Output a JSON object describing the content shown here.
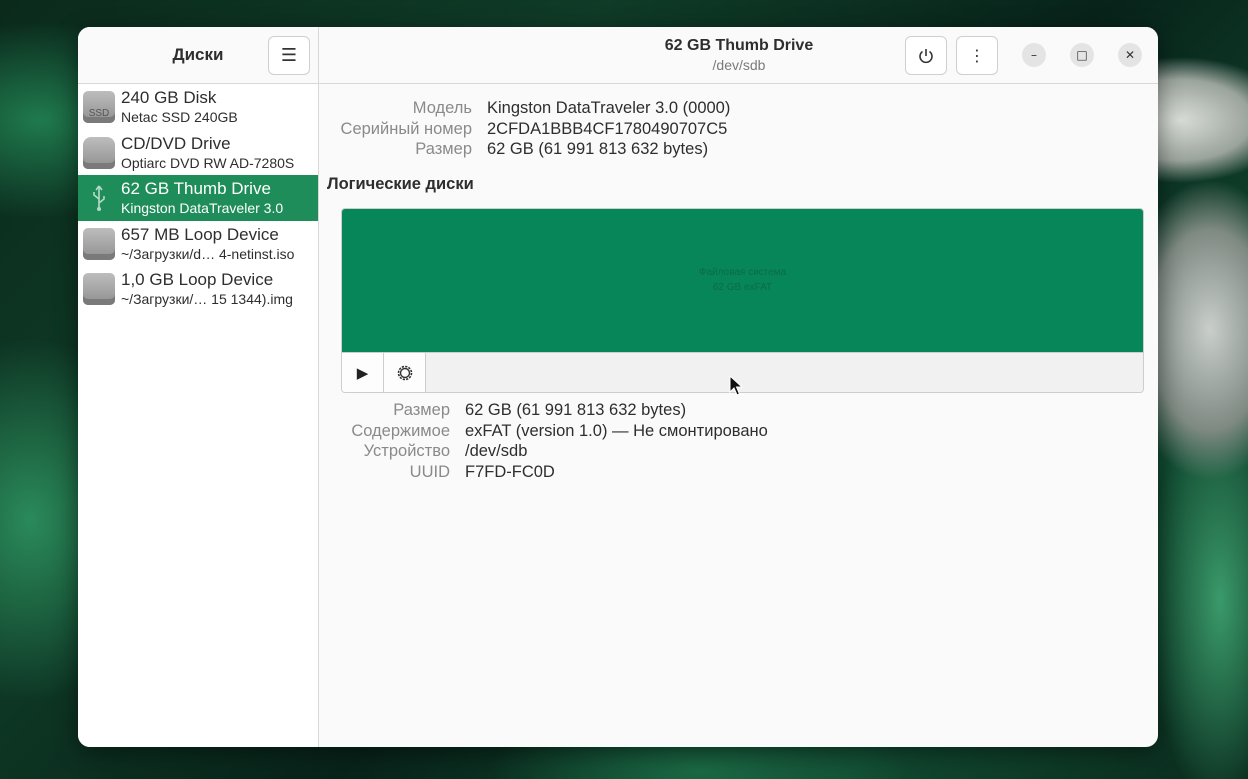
{
  "app": {
    "title": "Диски",
    "menu_icon": "hamburger-menu-icon"
  },
  "drives": [
    {
      "name": "240 GB Disk",
      "sub": "Netac SSD 240GB",
      "icon": "ssd-drive-icon",
      "icon_text": "SSD",
      "selected": false
    },
    {
      "name": "CD/DVD Drive",
      "sub": "Optiarc DVD RW AD-7280S",
      "icon": "optical-drive-icon",
      "icon_text": "",
      "selected": false
    },
    {
      "name": "62 GB Thumb Drive",
      "sub": "Kingston DataTraveler 3.0",
      "icon": "usb-drive-icon",
      "icon_text": "",
      "selected": true
    },
    {
      "name": "657 MB Loop Device",
      "sub": "~/Загрузки/d… 4-netinst.iso",
      "icon": "loop-device-icon",
      "icon_text": "",
      "selected": false
    },
    {
      "name": "1,0 GB Loop Device",
      "sub": "~/Загрузки/… 15 1344).img",
      "icon": "loop-device-icon",
      "icon_text": "",
      "selected": false
    }
  ],
  "header": {
    "title": "62 GB Thumb Drive",
    "subtitle": "/dev/sdb",
    "power_icon": "power-icon",
    "more_icon": "more-vertical-icon"
  },
  "drive_info": [
    {
      "label": "Модель",
      "value": "Kingston DataTraveler 3.0 (0000)"
    },
    {
      "label": "Серийный номер",
      "value": "2CFDA1BBB4CF1780490707C5"
    },
    {
      "label": "Размер",
      "value": "62 GB (61 991 813 632 bytes)"
    }
  ],
  "volumes": {
    "title": "Логические диски",
    "partition_line1": "Файловая система",
    "partition_line2": "62 GB exFAT",
    "partition_color": "#07865a",
    "mount_icon": "play-icon",
    "settings_icon": "gear-icon"
  },
  "volume_info": [
    {
      "label": "Размер",
      "value": "62 GB (61 991 813 632 bytes)"
    },
    {
      "label": "Содержимое",
      "value": "exFAT (version 1.0) — Не смонтировано"
    },
    {
      "label": "Устройство",
      "value": "/dev/sdb"
    },
    {
      "label": "UUID",
      "value": "F7FD-FC0D"
    }
  ],
  "colors": {
    "accent": "#1e8d5a",
    "partition": "#07865a"
  }
}
